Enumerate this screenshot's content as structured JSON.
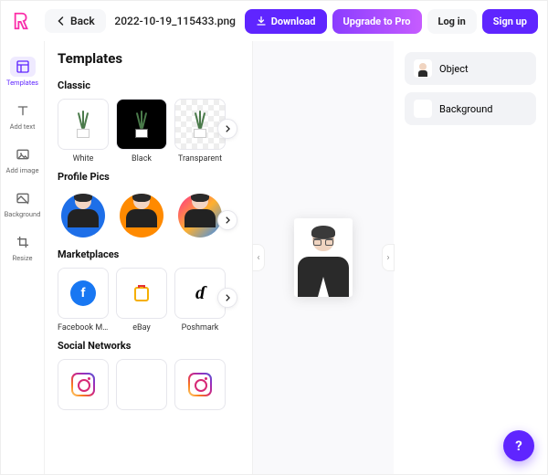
{
  "header": {
    "back": "Back",
    "filename": "2022-10-19_115433.png",
    "download": "Download",
    "upgrade": "Upgrade to Pro",
    "login": "Log in",
    "signup": "Sign up"
  },
  "tools": {
    "templates": "Templates",
    "addtext": "Add text",
    "addimage": "Add image",
    "background": "Background",
    "resize": "Resize"
  },
  "panel": {
    "title": "Templates",
    "classic": {
      "label": "Classic",
      "items": [
        "White",
        "Black",
        "Transparent"
      ]
    },
    "profile": {
      "label": "Profile Pics"
    },
    "market": {
      "label": "Marketplaces",
      "items": [
        "Facebook Ma…",
        "eBay",
        "Poshmark"
      ]
    },
    "social": {
      "label": "Social Networks"
    }
  },
  "props": {
    "object": "Object",
    "background": "Background"
  }
}
